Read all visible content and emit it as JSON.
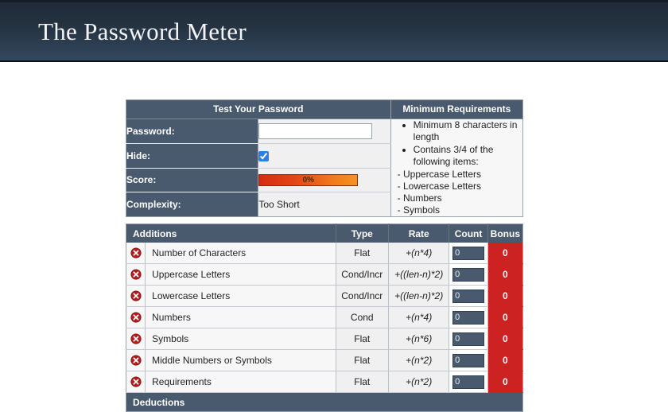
{
  "header": {
    "title": "The Password Meter"
  },
  "test_panel": {
    "heading": "Test Your Password",
    "password_label": "Password:",
    "password_value": "",
    "password_placeholder": "",
    "hide_label": "Hide:",
    "hide_checked": true,
    "score_label": "Score:",
    "score_percent": "0%",
    "score_value": 0,
    "complexity_label": "Complexity:",
    "complexity_value": "Too Short"
  },
  "requirements_panel": {
    "heading": "Minimum Requirements",
    "items": [
      "Minimum 8 characters in length",
      "Contains 3/4 of the following items:"
    ],
    "sub_items": [
      "- Uppercase Letters",
      "- Lowercase Letters",
      "- Numbers",
      "- Symbols"
    ]
  },
  "additions_table": {
    "headers": {
      "name": "Additions",
      "type": "Type",
      "rate": "Rate",
      "count": "Count",
      "bonus": "Bonus"
    },
    "rows": [
      {
        "status_icon": "error-x-icon",
        "name": "Number of Characters",
        "type": "Flat",
        "rate": "+(n*4)",
        "count": "0",
        "bonus": "0"
      },
      {
        "status_icon": "error-x-icon",
        "name": "Uppercase Letters",
        "type": "Cond/Incr",
        "rate": "+((len-n)*2)",
        "count": "0",
        "bonus": "0"
      },
      {
        "status_icon": "error-x-icon",
        "name": "Lowercase Letters",
        "type": "Cond/Incr",
        "rate": "+((len-n)*2)",
        "count": "0",
        "bonus": "0"
      },
      {
        "status_icon": "error-x-icon",
        "name": "Numbers",
        "type": "Cond",
        "rate": "+(n*4)",
        "count": "0",
        "bonus": "0"
      },
      {
        "status_icon": "error-x-icon",
        "name": "Symbols",
        "type": "Flat",
        "rate": "+(n*6)",
        "count": "0",
        "bonus": "0"
      },
      {
        "status_icon": "error-x-icon",
        "name": "Middle Numbers or Symbols",
        "type": "Flat",
        "rate": "+(n*2)",
        "count": "0",
        "bonus": "0"
      },
      {
        "status_icon": "error-x-icon",
        "name": "Requirements",
        "type": "Flat",
        "rate": "+(n*2)",
        "count": "0",
        "bonus": "0"
      }
    ]
  },
  "deductions_table": {
    "heading": "Deductions"
  },
  "colors": {
    "header_dark": "#24313f",
    "panel_header": "#4a5a6e",
    "bonus_red": "#cc2222",
    "score_bar_start": "#d62b12",
    "score_bar_end": "#f59324",
    "checkbox_blue": "#2a7fe0",
    "page_background": "#ffffff"
  }
}
